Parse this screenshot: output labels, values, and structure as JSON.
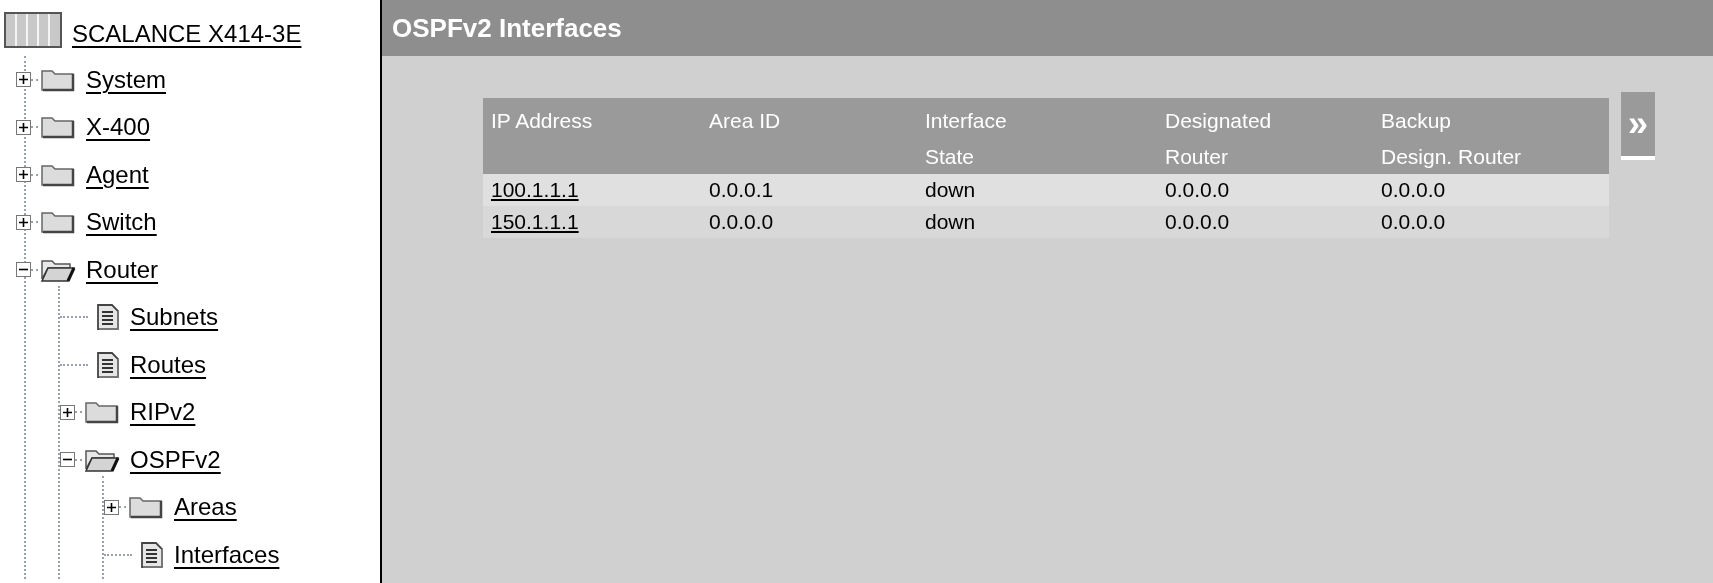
{
  "tree": {
    "label": "SCALANCE X414-3E",
    "children": [
      {
        "kind": "folder",
        "label": "System",
        "expanded": false
      },
      {
        "kind": "folder",
        "label": "X-400",
        "expanded": false
      },
      {
        "kind": "folder",
        "label": "Agent",
        "expanded": false
      },
      {
        "kind": "folder",
        "label": "Switch",
        "expanded": false
      },
      {
        "kind": "folder",
        "label": "Router",
        "expanded": true,
        "children": [
          {
            "kind": "page",
            "label": "Subnets"
          },
          {
            "kind": "page",
            "label": "Routes"
          },
          {
            "kind": "folder",
            "label": "RIPv2",
            "expanded": false
          },
          {
            "kind": "folder",
            "label": "OSPFv2",
            "expanded": true,
            "children": [
              {
                "kind": "folder",
                "label": "Areas",
                "expanded": false
              },
              {
                "kind": "page",
                "label": "Interfaces"
              }
            ]
          }
        ]
      }
    ]
  },
  "page": {
    "title": "OSPFv2 Interfaces"
  },
  "table": {
    "columns": [
      {
        "lines": [
          "IP Address"
        ]
      },
      {
        "lines": [
          "Area ID"
        ]
      },
      {
        "lines": [
          "Interface",
          "State"
        ]
      },
      {
        "lines": [
          "Designated",
          "Router"
        ]
      },
      {
        "lines": [
          "Backup",
          "Design. Router"
        ]
      }
    ],
    "rows": [
      {
        "cells": [
          "100.1.1.1",
          "0.0.0.1",
          "down",
          "0.0.0.0",
          "0.0.0.0"
        ]
      },
      {
        "cells": [
          "150.1.1.1",
          "0.0.0.0",
          "down",
          "0.0.0.0",
          "0.0.0.0"
        ]
      }
    ]
  },
  "next_button": {
    "label": "»"
  }
}
